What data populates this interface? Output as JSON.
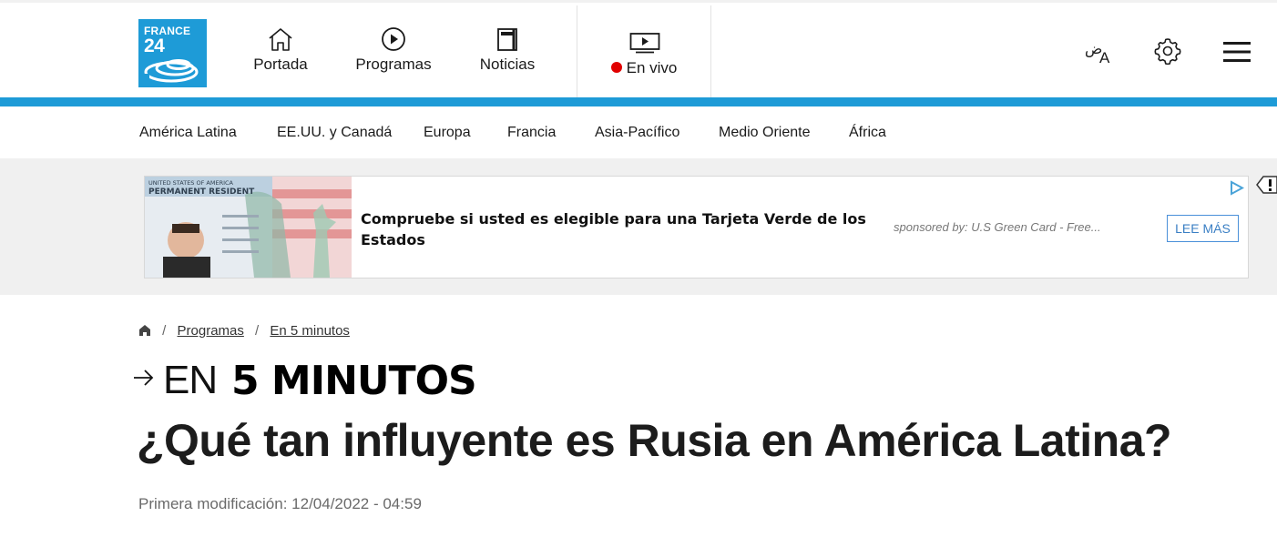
{
  "brand": {
    "logo_line1": "FRANCE",
    "logo_line2": "24",
    "color": "#1e9bd7"
  },
  "nav": {
    "home": "Portada",
    "programs": "Programas",
    "news": "Noticias",
    "live": "En vivo"
  },
  "regions": [
    "América Latina",
    "EE.UU. y Canadá",
    "Europa",
    "Francia",
    "Asia-Pacífico",
    "Medio Oriente",
    "África"
  ],
  "ad": {
    "card_header_1": "UNITED STATES OF AMERICA",
    "card_header_2": "PERMANENT RESIDENT",
    "title": "Compruebe si usted es elegible para una Tarjeta Verde de los Estados",
    "sponsor": "sponsored by: U.S Green Card - Free...",
    "button": "LEE MÁS"
  },
  "breadcrumb": {
    "programs": "Programas",
    "section": "En 5 minutos"
  },
  "kicker": {
    "light": "EN",
    "bold": "5 MINUTOS"
  },
  "headline": "¿Qué tan influyente es Rusia en América Latina?",
  "modified": "Primera modificación: 12/04/2022 - 04:59",
  "colors": {
    "accent": "#1e9bd7",
    "live": "#e10000",
    "ad_button": "#3a7fc4"
  }
}
